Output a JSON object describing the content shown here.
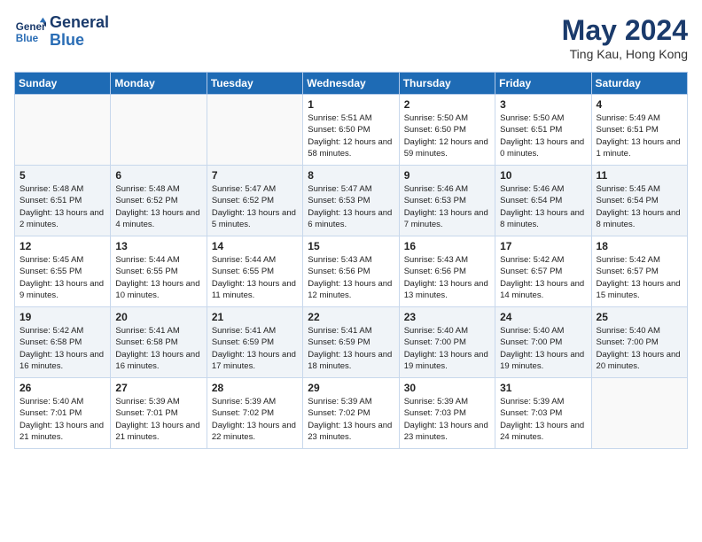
{
  "header": {
    "logo_line1": "General",
    "logo_line2": "Blue",
    "month_title": "May 2024",
    "location": "Ting Kau, Hong Kong"
  },
  "days_of_week": [
    "Sunday",
    "Monday",
    "Tuesday",
    "Wednesday",
    "Thursday",
    "Friday",
    "Saturday"
  ],
  "weeks": [
    [
      {
        "day": "",
        "info": ""
      },
      {
        "day": "",
        "info": ""
      },
      {
        "day": "",
        "info": ""
      },
      {
        "day": "1",
        "info": "Sunrise: 5:51 AM\nSunset: 6:50 PM\nDaylight: 12 hours\nand 58 minutes."
      },
      {
        "day": "2",
        "info": "Sunrise: 5:50 AM\nSunset: 6:50 PM\nDaylight: 12 hours\nand 59 minutes."
      },
      {
        "day": "3",
        "info": "Sunrise: 5:50 AM\nSunset: 6:51 PM\nDaylight: 13 hours\nand 0 minutes."
      },
      {
        "day": "4",
        "info": "Sunrise: 5:49 AM\nSunset: 6:51 PM\nDaylight: 13 hours\nand 1 minute."
      }
    ],
    [
      {
        "day": "5",
        "info": "Sunrise: 5:48 AM\nSunset: 6:51 PM\nDaylight: 13 hours\nand 2 minutes."
      },
      {
        "day": "6",
        "info": "Sunrise: 5:48 AM\nSunset: 6:52 PM\nDaylight: 13 hours\nand 4 minutes."
      },
      {
        "day": "7",
        "info": "Sunrise: 5:47 AM\nSunset: 6:52 PM\nDaylight: 13 hours\nand 5 minutes."
      },
      {
        "day": "8",
        "info": "Sunrise: 5:47 AM\nSunset: 6:53 PM\nDaylight: 13 hours\nand 6 minutes."
      },
      {
        "day": "9",
        "info": "Sunrise: 5:46 AM\nSunset: 6:53 PM\nDaylight: 13 hours\nand 7 minutes."
      },
      {
        "day": "10",
        "info": "Sunrise: 5:46 AM\nSunset: 6:54 PM\nDaylight: 13 hours\nand 8 minutes."
      },
      {
        "day": "11",
        "info": "Sunrise: 5:45 AM\nSunset: 6:54 PM\nDaylight: 13 hours\nand 8 minutes."
      }
    ],
    [
      {
        "day": "12",
        "info": "Sunrise: 5:45 AM\nSunset: 6:55 PM\nDaylight: 13 hours\nand 9 minutes."
      },
      {
        "day": "13",
        "info": "Sunrise: 5:44 AM\nSunset: 6:55 PM\nDaylight: 13 hours\nand 10 minutes."
      },
      {
        "day": "14",
        "info": "Sunrise: 5:44 AM\nSunset: 6:55 PM\nDaylight: 13 hours\nand 11 minutes."
      },
      {
        "day": "15",
        "info": "Sunrise: 5:43 AM\nSunset: 6:56 PM\nDaylight: 13 hours\nand 12 minutes."
      },
      {
        "day": "16",
        "info": "Sunrise: 5:43 AM\nSunset: 6:56 PM\nDaylight: 13 hours\nand 13 minutes."
      },
      {
        "day": "17",
        "info": "Sunrise: 5:42 AM\nSunset: 6:57 PM\nDaylight: 13 hours\nand 14 minutes."
      },
      {
        "day": "18",
        "info": "Sunrise: 5:42 AM\nSunset: 6:57 PM\nDaylight: 13 hours\nand 15 minutes."
      }
    ],
    [
      {
        "day": "19",
        "info": "Sunrise: 5:42 AM\nSunset: 6:58 PM\nDaylight: 13 hours\nand 16 minutes."
      },
      {
        "day": "20",
        "info": "Sunrise: 5:41 AM\nSunset: 6:58 PM\nDaylight: 13 hours\nand 16 minutes."
      },
      {
        "day": "21",
        "info": "Sunrise: 5:41 AM\nSunset: 6:59 PM\nDaylight: 13 hours\nand 17 minutes."
      },
      {
        "day": "22",
        "info": "Sunrise: 5:41 AM\nSunset: 6:59 PM\nDaylight: 13 hours\nand 18 minutes."
      },
      {
        "day": "23",
        "info": "Sunrise: 5:40 AM\nSunset: 7:00 PM\nDaylight: 13 hours\nand 19 minutes."
      },
      {
        "day": "24",
        "info": "Sunrise: 5:40 AM\nSunset: 7:00 PM\nDaylight: 13 hours\nand 19 minutes."
      },
      {
        "day": "25",
        "info": "Sunrise: 5:40 AM\nSunset: 7:00 PM\nDaylight: 13 hours\nand 20 minutes."
      }
    ],
    [
      {
        "day": "26",
        "info": "Sunrise: 5:40 AM\nSunset: 7:01 PM\nDaylight: 13 hours\nand 21 minutes."
      },
      {
        "day": "27",
        "info": "Sunrise: 5:39 AM\nSunset: 7:01 PM\nDaylight: 13 hours\nand 21 minutes."
      },
      {
        "day": "28",
        "info": "Sunrise: 5:39 AM\nSunset: 7:02 PM\nDaylight: 13 hours\nand 22 minutes."
      },
      {
        "day": "29",
        "info": "Sunrise: 5:39 AM\nSunset: 7:02 PM\nDaylight: 13 hours\nand 23 minutes."
      },
      {
        "day": "30",
        "info": "Sunrise: 5:39 AM\nSunset: 7:03 PM\nDaylight: 13 hours\nand 23 minutes."
      },
      {
        "day": "31",
        "info": "Sunrise: 5:39 AM\nSunset: 7:03 PM\nDaylight: 13 hours\nand 24 minutes."
      },
      {
        "day": "",
        "info": ""
      }
    ]
  ]
}
